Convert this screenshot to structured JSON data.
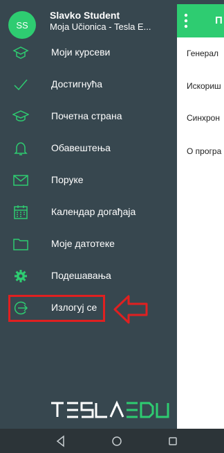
{
  "user": {
    "initials": "SS",
    "name": "Slavko Student",
    "site": "Moja Učionica - Tesla E..."
  },
  "menu": [
    {
      "label": "Моји курсеви",
      "icon": "courses-icon"
    },
    {
      "label": "Достигнућа",
      "icon": "checkmark-icon"
    },
    {
      "label": "Почетна страна",
      "icon": "graduation-cap-icon"
    },
    {
      "label": "Обавештења",
      "icon": "bell-icon"
    },
    {
      "label": "Поруке",
      "icon": "envelope-icon"
    },
    {
      "label": "Календар догађаја",
      "icon": "calendar-icon"
    },
    {
      "label": "Моје датотеке",
      "icon": "folder-icon"
    },
    {
      "label": "Подешавања",
      "icon": "gear-icon"
    },
    {
      "label": "Излогуј се",
      "icon": "logout-icon"
    }
  ],
  "logo": "TESLAEDU",
  "main": {
    "title": "П",
    "rows": [
      "Генерал",
      "Искориш",
      "Синхрон",
      "О програ"
    ]
  },
  "colors": {
    "drawer": "#37474f",
    "accent": "#2ecc71",
    "highlight": "#e02020"
  }
}
